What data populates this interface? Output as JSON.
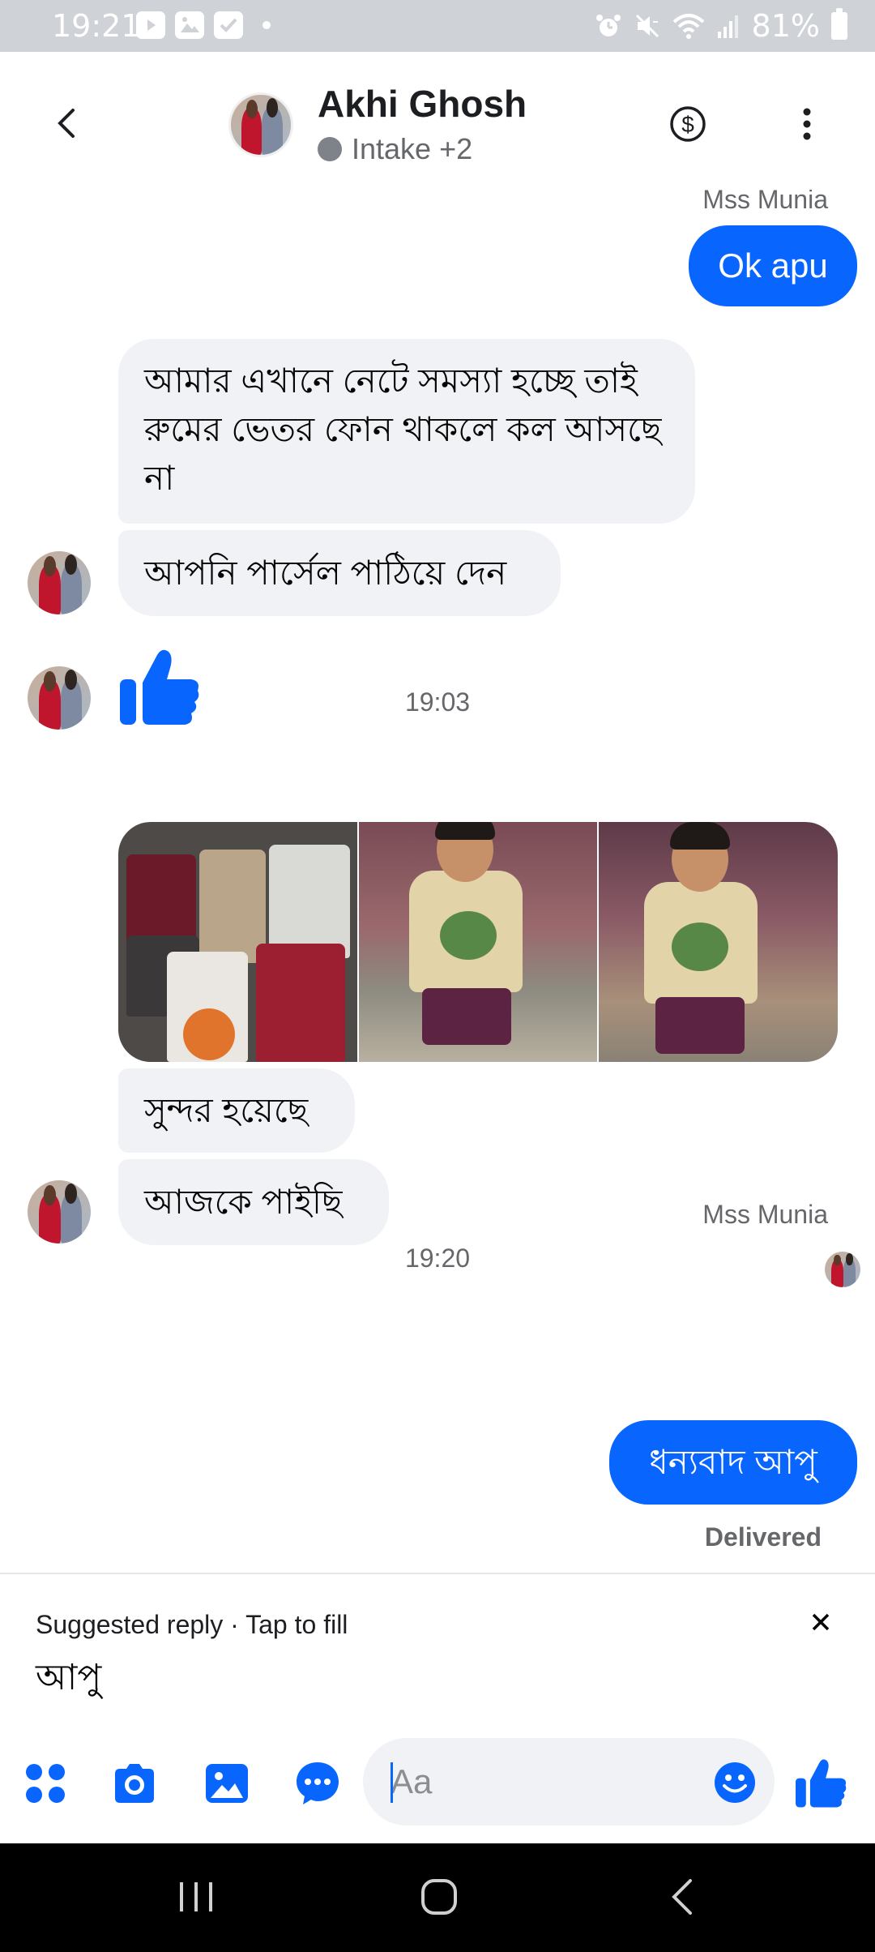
{
  "status_bar": {
    "time": "19:21",
    "battery": "81%",
    "icons": [
      "youtube-icon",
      "gallery-icon",
      "checklist-icon",
      "dot-icon",
      "alarm-icon",
      "mute-icon",
      "wifi-icon",
      "signal-icon",
      "battery-icon"
    ]
  },
  "header": {
    "contact_name": "Akhi Ghosh",
    "presence": "Intake +2"
  },
  "messages": {
    "cut_sender": "Mss Munia",
    "ok_apu": "Ok apu",
    "in_long": "আমার এখানে নেটে সমস্যা হচ্ছে তাই রুমের ভেতর  ফোন থাকলে কল আসছে না",
    "in_parcel": "আপনি পার্সেল পাঠিয়ে দেন",
    "time_1": "19:03",
    "in_sundor": "সুন্দর হয়েছে",
    "in_aajke": "আজকে পাইছি",
    "time_2": "19:20",
    "sender_label": "Mss Munia",
    "out_thanks": "ধন্যবাদ আপু",
    "delivered": "Delivered"
  },
  "suggested": {
    "label": "Suggested reply · Tap to fill",
    "text": "আপু"
  },
  "composer": {
    "placeholder": "Aa"
  },
  "colors": {
    "accent": "#0866ff",
    "bubble_in": "#f0f2f5",
    "status_bar": "#cfd2d6"
  }
}
